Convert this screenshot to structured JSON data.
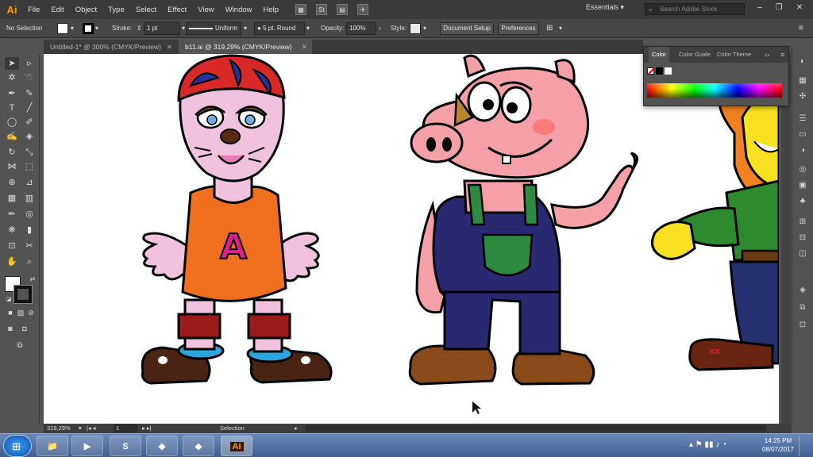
{
  "app": {
    "logo": "Ai",
    "menu": [
      "File",
      "Edit",
      "Object",
      "Type",
      "Select",
      "Effect",
      "View",
      "Window",
      "Help"
    ],
    "workspace": "Essentials",
    "search_placeholder": "Search Adobe Stock"
  },
  "control_bar": {
    "selection": "No Selection",
    "stroke_label": "Stroke:",
    "stroke_weight": "1 pt",
    "profile": "Uniform",
    "brush": "5 pt. Round",
    "opacity_label": "Opacity:",
    "opacity": "100%",
    "style_label": "Style:",
    "document_setup": "Document Setup",
    "preferences": "Preferences"
  },
  "tabs": [
    {
      "label": "Untitled-1* @ 300% (CMYK/Preview)",
      "active": false
    },
    {
      "label": "b11.ai @ 319,29% (CMYK/Preview)",
      "active": true
    }
  ],
  "color_panel": {
    "tabs": [
      "Color",
      "Color Guide",
      "Color Theme"
    ]
  },
  "status": {
    "zoom": "319,29%",
    "artboard": "1",
    "tool": "Selection"
  },
  "taskbar": {
    "time": "14:25 PM",
    "date": "08/07/2017",
    "ai_label": "Ai"
  }
}
